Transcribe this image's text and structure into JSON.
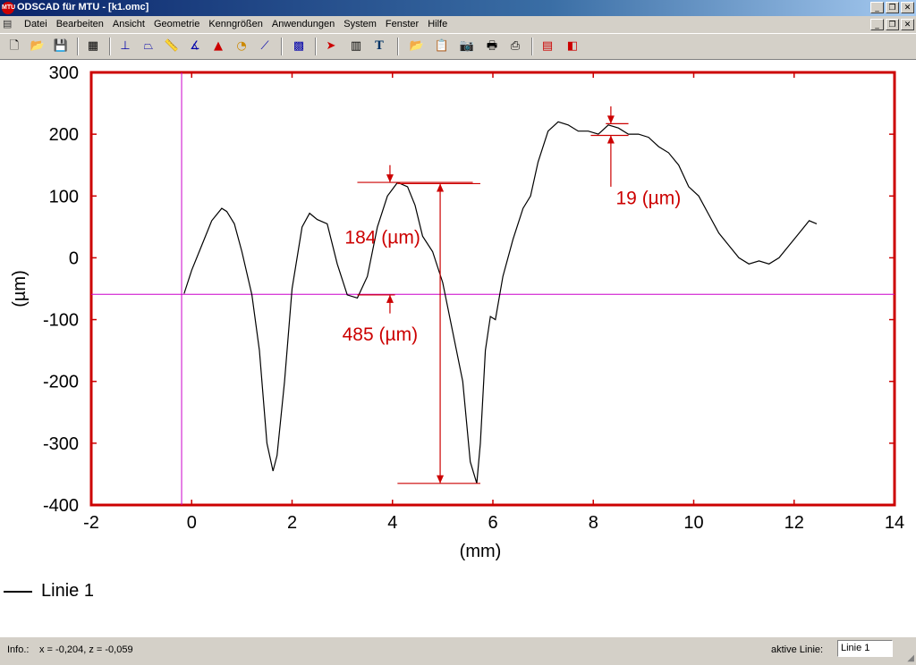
{
  "window": {
    "title": "ODSCAD für MTU - [k1.omc]",
    "app_icon_text": "MTU",
    "controls": [
      "_",
      "❐",
      "✕"
    ]
  },
  "menu": {
    "items": [
      "Datei",
      "Bearbeiten",
      "Ansicht",
      "Geometrie",
      "Kenngrößen",
      "Anwendungen",
      "System",
      "Fenster",
      "Hilfe"
    ]
  },
  "toolbar": {
    "icons": [
      "new-icon",
      "open-icon",
      "save-icon",
      "table-icon",
      "measure-icon",
      "trapezoid-icon",
      "ruler-icon",
      "angle-icon",
      "triangle-icon",
      "radius-icon",
      "line-icon",
      "grid-icon",
      "export-icon",
      "report-icon",
      "text-icon",
      "folder-open-icon",
      "clipboard-icon",
      "camera-icon",
      "print-preview-icon",
      "print-icon",
      "color-icon",
      "layer-icon"
    ]
  },
  "chart_data": {
    "type": "line",
    "xlabel": "(mm)",
    "ylabel": "(µm)",
    "xlim": [
      -2,
      14
    ],
    "ylim": [
      -400,
      300
    ],
    "xticks": [
      "-2",
      "0",
      "2",
      "4",
      "6",
      "8",
      "10",
      "12",
      "14"
    ],
    "yticks": [
      "300",
      "200",
      "100",
      "0",
      "-100",
      "-200",
      "-300",
      "-400"
    ],
    "series": [
      {
        "name": "Linie 1",
        "color": "#000000",
        "x": [
          -0.15,
          0.0,
          0.2,
          0.4,
          0.6,
          0.7,
          0.85,
          1.0,
          1.2,
          1.35,
          1.5,
          1.62,
          1.7,
          1.85,
          2.0,
          2.2,
          2.35,
          2.5,
          2.7,
          2.9,
          3.1,
          3.3,
          3.5,
          3.7,
          3.9,
          4.1,
          4.3,
          4.45,
          4.6,
          4.8,
          5.0,
          5.2,
          5.4,
          5.55,
          5.68,
          5.75,
          5.85,
          5.95,
          6.05,
          6.2,
          6.4,
          6.6,
          6.75,
          6.9,
          7.1,
          7.3,
          7.5,
          7.7,
          7.9,
          8.1,
          8.3,
          8.5,
          8.7,
          8.9,
          9.1,
          9.3,
          9.5,
          9.7,
          9.9,
          10.1,
          10.3,
          10.5,
          10.7,
          10.9,
          11.1,
          11.3,
          11.5,
          11.7,
          11.9,
          12.1,
          12.3,
          12.45
        ],
        "y": [
          -58,
          -20,
          20,
          60,
          80,
          75,
          55,
          10,
          -60,
          -150,
          -300,
          -345,
          -320,
          -200,
          -50,
          50,
          72,
          62,
          55,
          -10,
          -60,
          -65,
          -30,
          50,
          100,
          122,
          115,
          85,
          35,
          10,
          -40,
          -120,
          -200,
          -330,
          -365,
          -300,
          -150,
          -95,
          -100,
          -30,
          30,
          80,
          100,
          155,
          205,
          220,
          215,
          205,
          205,
          200,
          215,
          210,
          200,
          200,
          195,
          180,
          170,
          150,
          115,
          100,
          70,
          40,
          20,
          0,
          -10,
          -5,
          -10,
          0,
          20,
          40,
          60,
          55
        ]
      }
    ],
    "reference_lines": {
      "horizontal_y": -59,
      "vertical_x": -0.2
    },
    "annotations": [
      {
        "label": "19   (µm)",
        "value": 19
      },
      {
        "label": "184   (µm)",
        "value": 184
      },
      {
        "label": "485   (µm)",
        "value": 485
      }
    ],
    "frame_color": "#cc0000",
    "annotation_color": "#cc0000",
    "reference_color": "#cc00cc",
    "grid": false,
    "legend_position": "bottom-left"
  },
  "legend": {
    "label": "Linie 1"
  },
  "status": {
    "info_label": "Info.:",
    "info_text": "x = -0,204, z = -0,059",
    "active_line_label": "aktive Linie:",
    "active_line_value": "Linie 1"
  }
}
